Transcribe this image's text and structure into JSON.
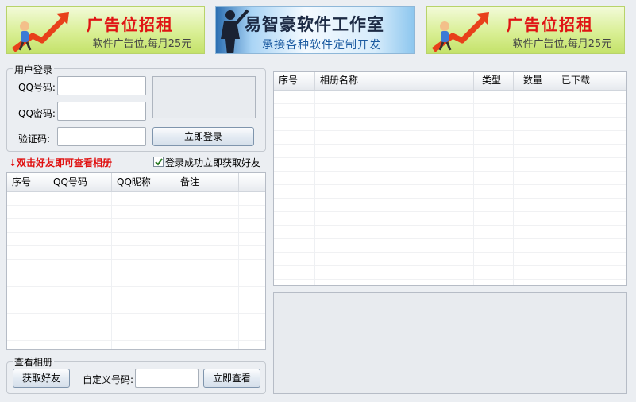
{
  "banners": {
    "left_ad": {
      "title": "广告位招租",
      "subtitle": "软件广告位,每月25元"
    },
    "center": {
      "title": "易智豪软件工作室",
      "subtitle": "承接各种软件定制开发"
    },
    "right_ad": {
      "title": "广告位招租",
      "subtitle": "软件广告位,每月25元"
    }
  },
  "login": {
    "legend": "用户登录",
    "qq_number_label": "QQ号码:",
    "qq_password_label": "QQ密码:",
    "captcha_label": "验证码:",
    "qq_number_value": "",
    "qq_password_value": "",
    "captcha_value": "",
    "login_button": "立即登录"
  },
  "hint": "↓双击好友即可查看相册",
  "auto_fetch": {
    "label": "登录成功立即获取好友",
    "checked": true
  },
  "friends_table": {
    "columns": [
      "序号",
      "QQ号码",
      "QQ昵称",
      "备注"
    ],
    "rows": []
  },
  "albums_table": {
    "columns": [
      "序号",
      "相册名称",
      "类型",
      "数量",
      "已下载"
    ],
    "rows": []
  },
  "view_album": {
    "legend": "查看相册",
    "get_friends_button": "获取好友",
    "custom_qq_label": "自定义号码:",
    "custom_qq_value": "",
    "view_now_button": "立即查看"
  },
  "colors": {
    "accent_red": "#e01010",
    "ad_green": "#c4e26a",
    "border": "#b6bcc6"
  }
}
